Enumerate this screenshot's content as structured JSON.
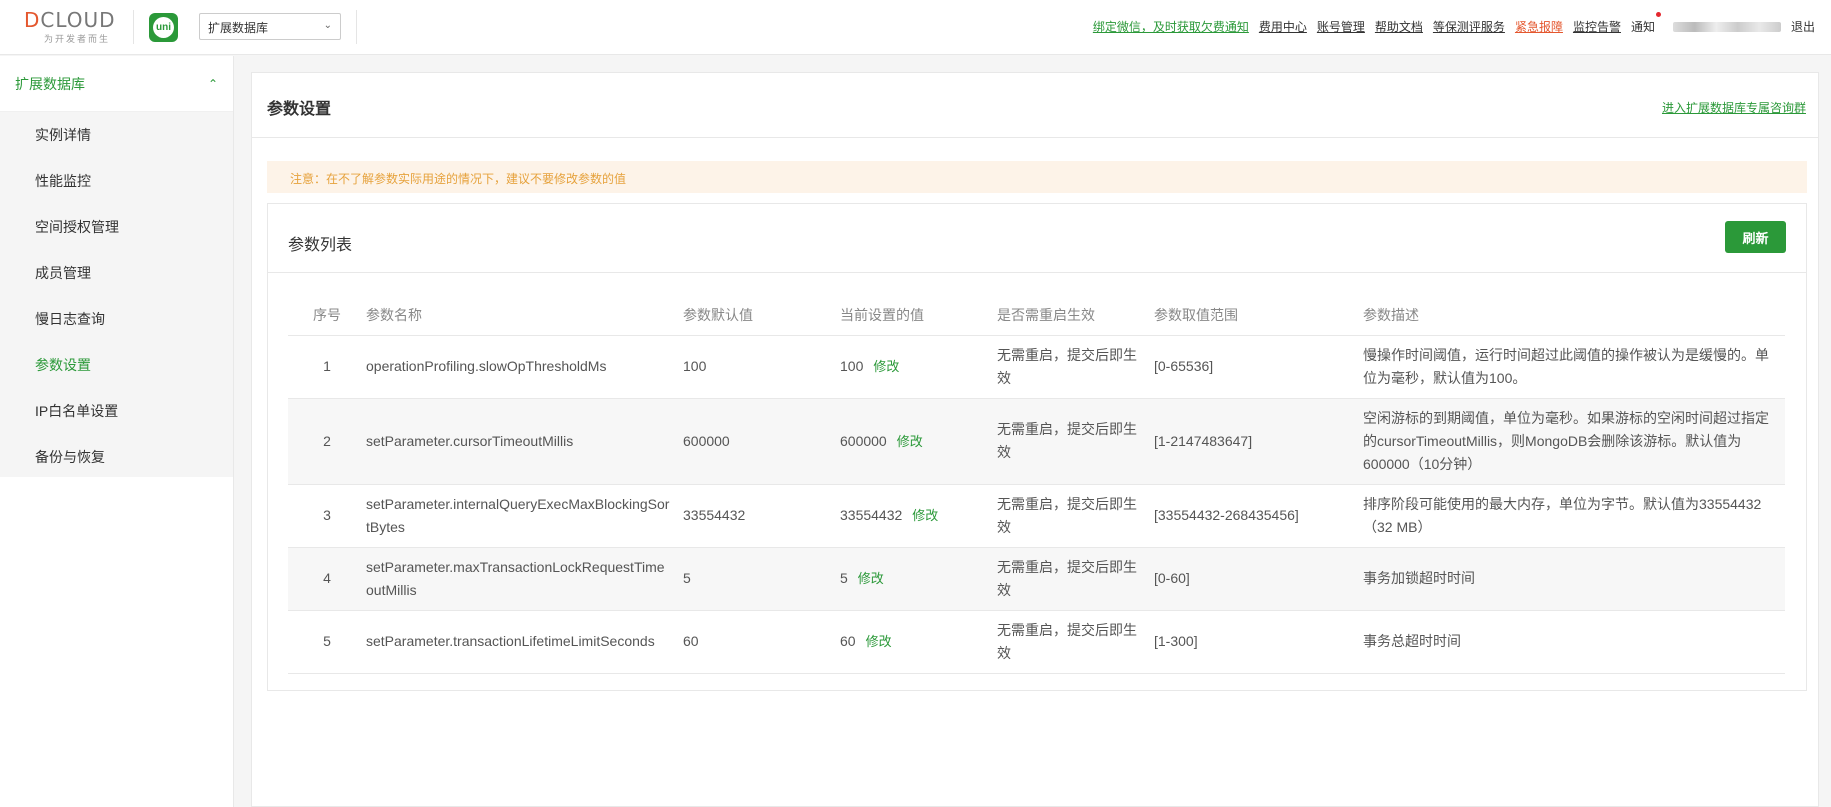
{
  "header": {
    "logo_text": "DCLOUD",
    "logo_slogan": "为开发者而生",
    "uni_badge": "uni",
    "db_select": "扩展数据库",
    "nav": [
      {
        "label": "绑定微信，及时获取欠费通知",
        "style": "green"
      },
      {
        "label": "费用中心",
        "style": "normal"
      },
      {
        "label": "账号管理",
        "style": "normal"
      },
      {
        "label": "帮助文档",
        "style": "normal"
      },
      {
        "label": "等保测评服务",
        "style": "normal"
      },
      {
        "label": "紧急报障",
        "style": "red"
      },
      {
        "label": "监控告警",
        "style": "normal"
      }
    ],
    "notify": "通知",
    "logout": "退出"
  },
  "sidebar": {
    "group": "扩展数据库",
    "items": [
      {
        "label": "实例详情",
        "active": false
      },
      {
        "label": "性能监控",
        "active": false
      },
      {
        "label": "空间授权管理",
        "active": false
      },
      {
        "label": "成员管理",
        "active": false
      },
      {
        "label": "慢日志查询",
        "active": false
      },
      {
        "label": "参数设置",
        "active": true
      },
      {
        "label": "IP白名单设置",
        "active": false
      },
      {
        "label": "备份与恢复",
        "active": false
      }
    ]
  },
  "main": {
    "title": "参数设置",
    "consult_link": "进入扩展数据库专属咨询群",
    "notice": "注意：在不了解参数实际用途的情况下，建议不要修改参数的值",
    "card_title": "参数列表",
    "refresh": "刷新",
    "columns": [
      "序号",
      "参数名称",
      "参数默认值",
      "当前设置的值",
      "是否需重启生效",
      "参数取值范围",
      "参数描述"
    ],
    "edit_label": "修改",
    "rows": [
      {
        "no": "1",
        "name": "operationProfiling.slowOpThresholdMs",
        "default": "100",
        "current": "100",
        "restart": "无需重启，提交后即生效",
        "range": "[0-65536]",
        "desc": "慢操作时间阈值，运行时间超过此阈值的操作被认为是缓慢的。单位为毫秒，默认值为100。"
      },
      {
        "no": "2",
        "name": "setParameter.cursorTimeoutMillis",
        "default": "600000",
        "current": "600000",
        "restart": "无需重启，提交后即生效",
        "range": "[1-2147483647]",
        "desc": "空闲游标的到期阈值，单位为毫秒。如果游标的空闲时间超过指定的cursorTimeoutMillis，则MongoDB会删除该游标。默认值为600000（10分钟）"
      },
      {
        "no": "3",
        "name": "setParameter.internalQueryExecMaxBlockingSortBytes",
        "default": "33554432",
        "current": "33554432",
        "restart": "无需重启，提交后即生效",
        "range": "[33554432-268435456]",
        "desc": "排序阶段可能使用的最大内存，单位为字节。默认值为33554432（32 MB）"
      },
      {
        "no": "4",
        "name": "setParameter.maxTransactionLockRequestTimeoutMillis",
        "default": "5",
        "current": "5",
        "restart": "无需重启，提交后即生效",
        "range": "[0-60]",
        "desc": "事务加锁超时时间"
      },
      {
        "no": "5",
        "name": "setParameter.transactionLifetimeLimitSeconds",
        "default": "60",
        "current": "60",
        "restart": "无需重启，提交后即生效",
        "range": "[1-300]",
        "desc": "事务总超时时间"
      }
    ]
  }
}
